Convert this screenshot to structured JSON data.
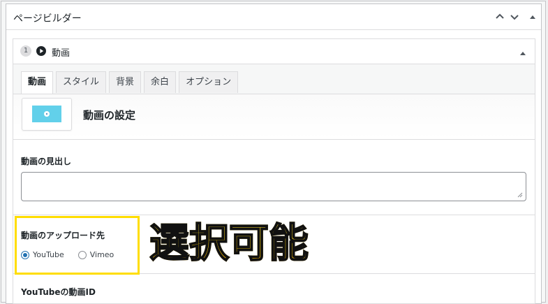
{
  "metabox": {
    "title": "ページビルダー"
  },
  "panel": {
    "number": "1",
    "title": "動画"
  },
  "tabs": [
    {
      "label": "動画",
      "active": true
    },
    {
      "label": "スタイル",
      "active": false
    },
    {
      "label": "背景",
      "active": false
    },
    {
      "label": "余白",
      "active": false
    },
    {
      "label": "オプション",
      "active": false
    }
  ],
  "settings": {
    "title": "動画の設定",
    "heading_label": "動画の見出し",
    "heading_value": "",
    "upload_label": "動画のアップロード先",
    "upload_options": [
      {
        "label": "YouTube",
        "checked": true
      },
      {
        "label": "Vimeo",
        "checked": false
      }
    ],
    "youtube_id_label": "YouTubeの動画ID"
  },
  "annotation": {
    "callout_text": "選択可能",
    "highlight_color": "#ffdd00"
  },
  "icons": {
    "move_up": "chevron-up-icon",
    "move_down": "chevron-down-icon",
    "collapse": "triangle-up-icon",
    "panel_type": "play-circle-icon"
  },
  "colors": {
    "accent": "#2271b1",
    "thumbnail": "#62d0ea",
    "callout": "#ffc400"
  }
}
